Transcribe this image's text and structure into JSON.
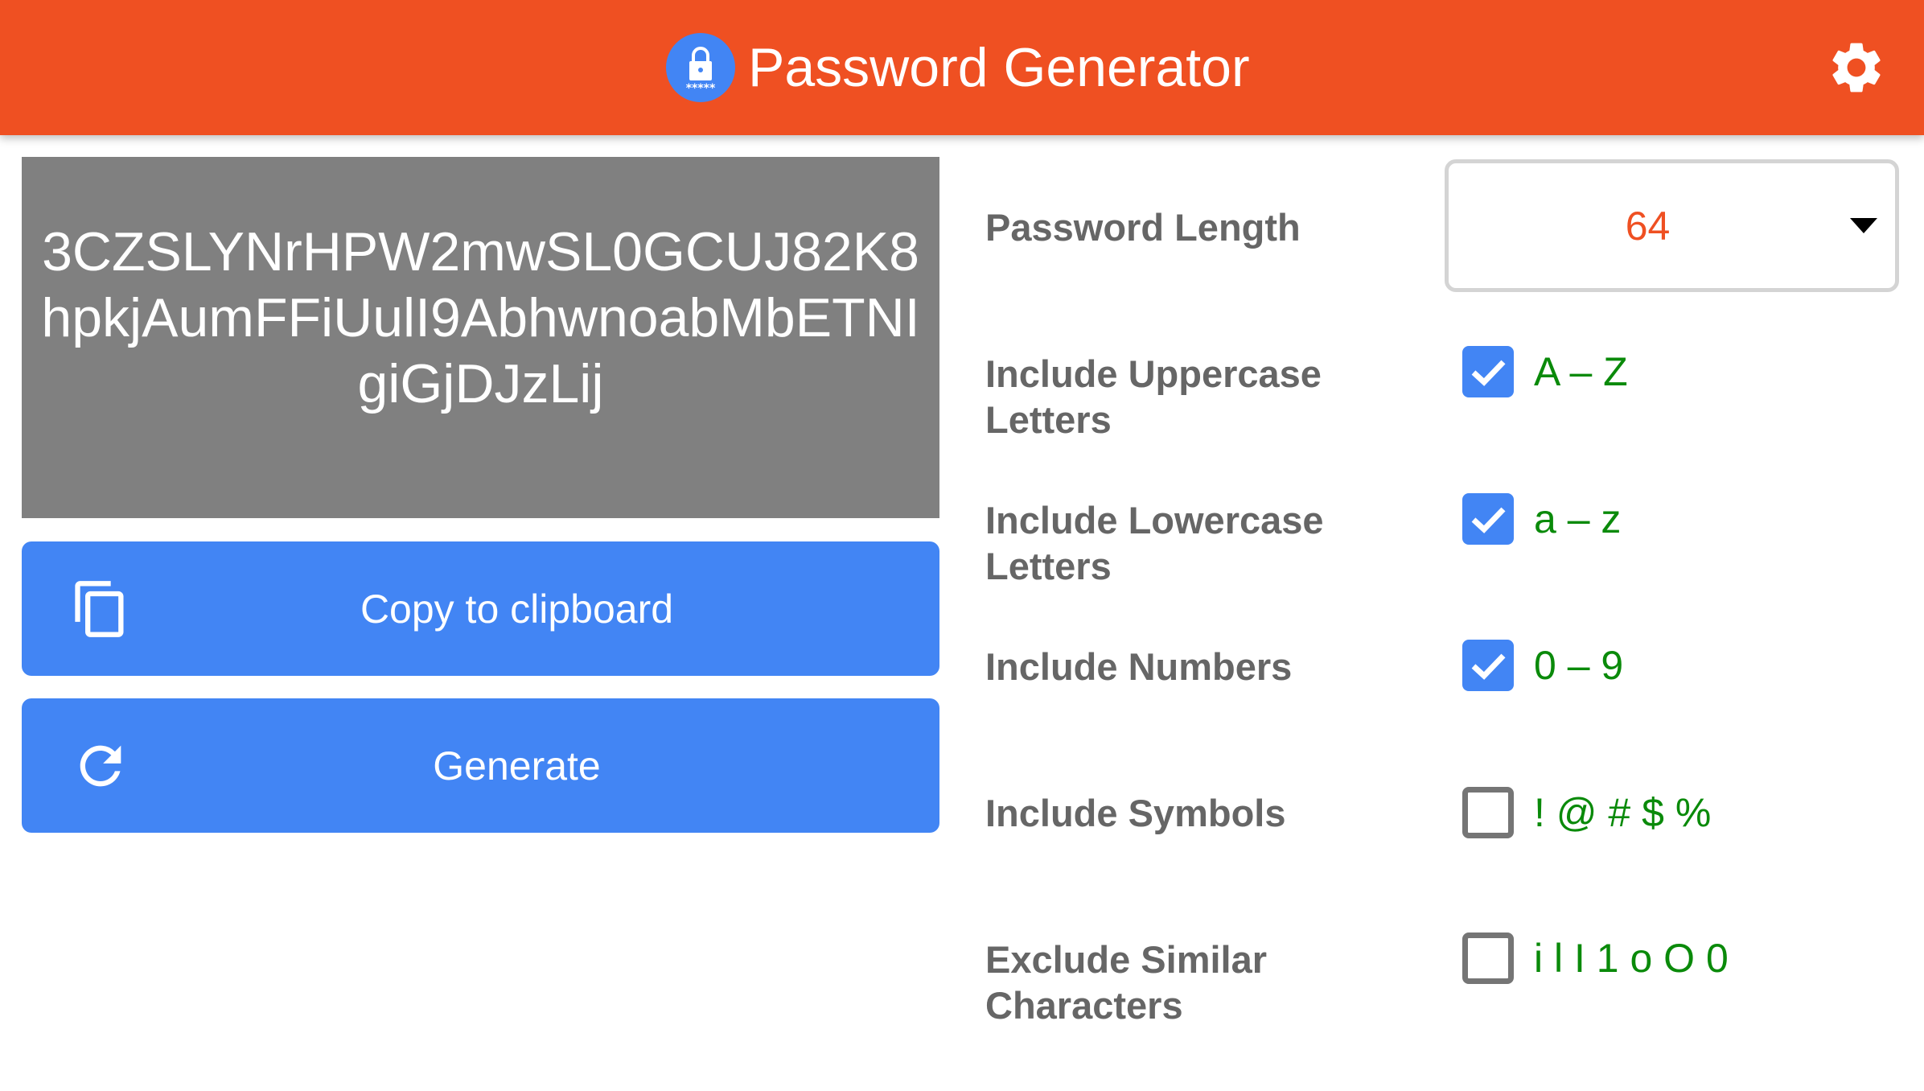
{
  "header": {
    "title": "Password Generator",
    "logo_icon": "lock-password-icon",
    "settings_icon": "gear-icon",
    "background_color": "#EF5022"
  },
  "password": {
    "value": "3CZSLYNrHPW2mwSL0GCUJ82K8hpkjAumFFiUulI9AbhwnoabMbETNIgiGjDJzLij"
  },
  "buttons": {
    "copy_label": "Copy to clipboard",
    "copy_icon": "copy-icon",
    "generate_label": "Generate",
    "generate_icon": "refresh-icon",
    "color": "#4285F4"
  },
  "settings": {
    "length_label": "Password Length",
    "length_value": "64",
    "options": [
      {
        "label": "Include Uppercase Letters",
        "chars": "A – Z",
        "checked": true
      },
      {
        "label": "Include Lowercase Letters",
        "chars": "a – z",
        "checked": true
      },
      {
        "label": "Include Numbers",
        "chars": "0 – 9",
        "checked": true
      },
      {
        "label": "Include Symbols",
        "chars": "! @ # $ %",
        "checked": false
      },
      {
        "label": "Exclude Similar Characters",
        "chars": "i l I 1 o O 0",
        "checked": false
      }
    ]
  }
}
